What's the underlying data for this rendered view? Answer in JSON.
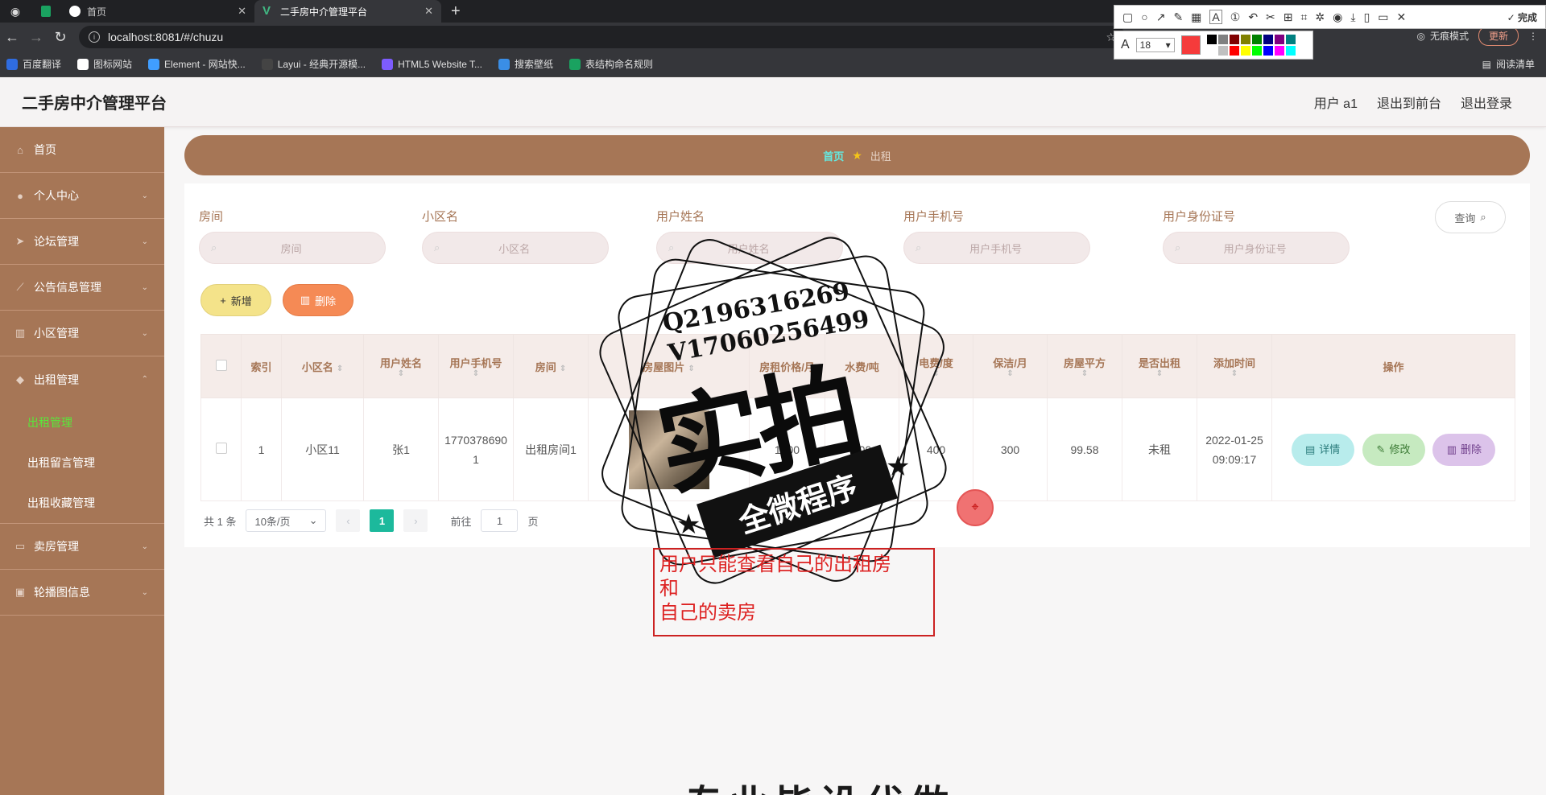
{
  "browser": {
    "tabs": [
      {
        "label": "首页",
        "active": false
      },
      {
        "label": "二手房中介管理平台",
        "active": true
      }
    ],
    "address": "localhost:8081/#/chuzu",
    "incognito_label": "无痕模式",
    "update_label": "更新",
    "bookmarks": [
      "百度翻译",
      "图标网站",
      "Element - 网站快...",
      "Layui - 经典开源模...",
      "HTML5 Website T...",
      "搜索壁纸",
      "表结构命名规则"
    ],
    "reading_list": "阅读清单"
  },
  "annotation_tool": {
    "done_label": "完成",
    "font_size": "18",
    "current_color": "#f53b3b",
    "palette": [
      "#000000",
      "#808080",
      "#800000",
      "#808000",
      "#008000",
      "#000080",
      "#800080",
      "#008080",
      "#ffffff",
      "#c0c0c0",
      "#ff0000",
      "#ffff00",
      "#00ff00",
      "#0000ff",
      "#ff00ff",
      "#00ffff"
    ]
  },
  "header": {
    "title": "二手房中介管理平台",
    "user": "用户 a1",
    "back_front": "退出到前台",
    "logout": "退出登录"
  },
  "sidebar": {
    "items": [
      {
        "label": "首页",
        "icon": "home-icon"
      },
      {
        "label": "个人中心",
        "icon": "user-icon"
      },
      {
        "label": "论坛管理",
        "icon": "send-icon"
      },
      {
        "label": "公告信息管理",
        "icon": "notice-icon"
      },
      {
        "label": "小区管理",
        "icon": "chart-icon"
      },
      {
        "label": "出租管理",
        "icon": "location-icon"
      },
      {
        "label": "卖房管理",
        "icon": "keyboard-icon"
      },
      {
        "label": "轮播图信息",
        "icon": "briefcase-icon"
      }
    ],
    "submenu": [
      "出租管理",
      "出租留言管理",
      "出租收藏管理"
    ]
  },
  "breadcrumb": {
    "home": "首页",
    "current": "出租"
  },
  "filters": [
    {
      "label": "房间",
      "placeholder": "房间"
    },
    {
      "label": "小区名",
      "placeholder": "小区名"
    },
    {
      "label": "用户姓名",
      "placeholder": "用户姓名"
    },
    {
      "label": "用户手机号",
      "placeholder": "用户手机号"
    },
    {
      "label": "用户身份证号",
      "placeholder": "用户身份证号"
    }
  ],
  "actions": {
    "query": "查询",
    "add": "新增",
    "delete": "删除"
  },
  "table": {
    "columns": [
      "索引",
      "小区名",
      "用户姓名",
      "用户手机号",
      "房间",
      "房屋图片",
      "房租价格/月",
      "水费/吨",
      "电费/度",
      "保洁/月",
      "房屋平方",
      "是否出租",
      "添加时间",
      "操作"
    ],
    "rows": [
      {
        "index": "1",
        "community": "小区11",
        "name": "张1",
        "phone": "17703786901",
        "room": "出租房间1",
        "price": "1000",
        "water": "500",
        "electric": "400",
        "cleaning": "300",
        "area": "99.58",
        "rented": "未租",
        "added": "2022-01-25 09:09:17"
      }
    ],
    "ops": {
      "detail": "详情",
      "edit": "修改",
      "delete": "删除"
    }
  },
  "pager": {
    "total": "共 1 条",
    "page_size": "10条/页",
    "current": "1",
    "goto_prefix": "前往",
    "goto_value": "1",
    "goto_suffix": "页"
  },
  "overlay": {
    "stamp_contact_1": "Q2196316269",
    "stamp_contact_2": "V17060256499",
    "stamp_big": "实拍",
    "stamp_ribbon": "全微程序",
    "note": "用户只能查看自己的出租房\n和\n自己的卖房",
    "bottom_text": "专业毕设代做"
  }
}
